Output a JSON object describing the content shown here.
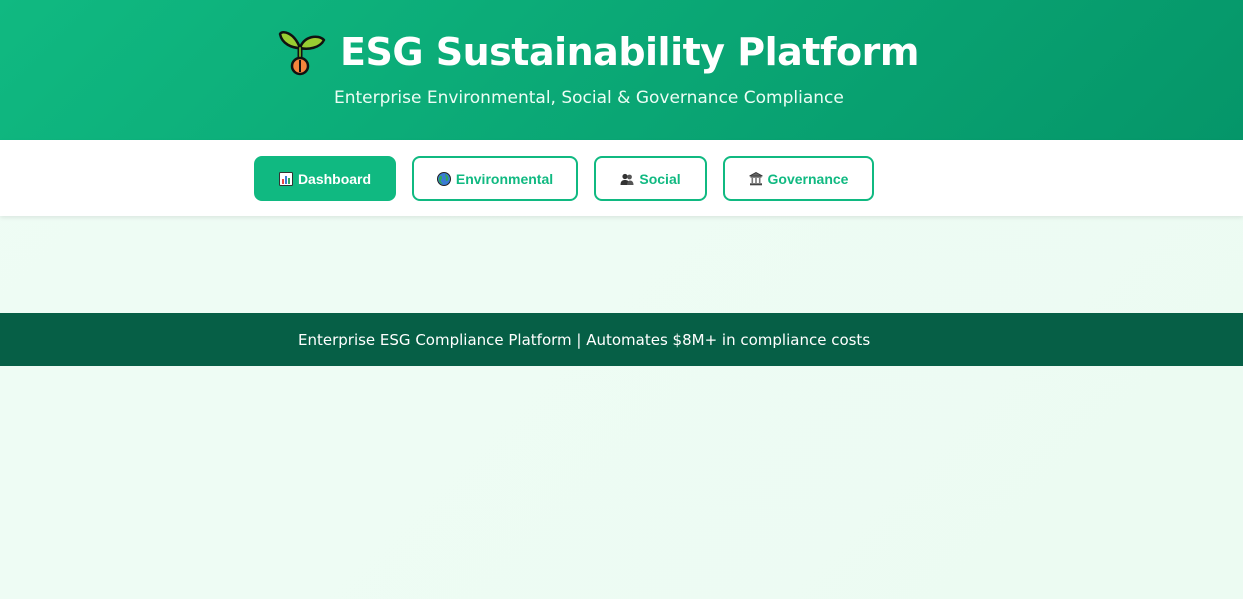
{
  "header": {
    "title": "ESG Sustainability Platform",
    "subtitle": "Enterprise Environmental, Social & Governance Compliance",
    "logo_icon": "seedling-icon"
  },
  "nav": {
    "tabs": [
      {
        "label": "Dashboard",
        "icon": "bar-chart-icon",
        "active": true
      },
      {
        "label": "Environmental",
        "icon": "globe-icon",
        "active": false
      },
      {
        "label": "Social",
        "icon": "people-icon",
        "active": false
      },
      {
        "label": "Governance",
        "icon": "classical-building-icon",
        "active": false
      }
    ]
  },
  "banner": {
    "text": "Enterprise ESG Compliance Platform | Automates $8M+ in compliance costs"
  },
  "colors": {
    "primary": "#10b981",
    "primary_dark": "#059669",
    "banner_bg": "#065f46",
    "page_bg": "#effcf5"
  }
}
